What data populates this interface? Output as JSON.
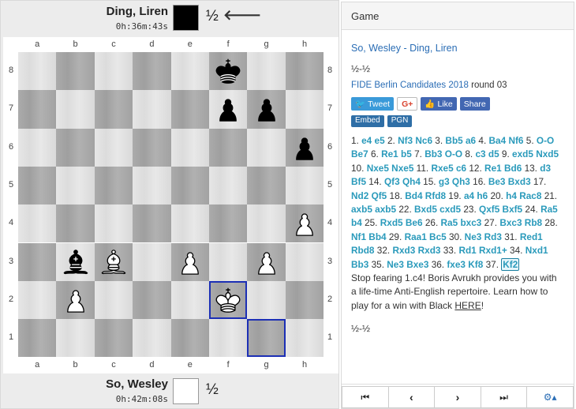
{
  "top_player": {
    "name": "Ding, Liren",
    "clock": "0h:36m:43s",
    "result": "½",
    "turn_arrow": "🡐"
  },
  "bottom_player": {
    "name": "So, Wesley",
    "clock": "0h:42m:08s",
    "result": "½"
  },
  "board": {
    "files": [
      "a",
      "b",
      "c",
      "d",
      "e",
      "f",
      "g",
      "h"
    ],
    "ranks": [
      "8",
      "7",
      "6",
      "5",
      "4",
      "3",
      "2",
      "1"
    ],
    "pieces": [
      {
        "square": "f8",
        "piece": "bk",
        "icon": "black-king-icon"
      },
      {
        "square": "f7",
        "piece": "bp",
        "icon": "black-pawn-icon"
      },
      {
        "square": "g7",
        "piece": "bp",
        "icon": "black-pawn-icon"
      },
      {
        "square": "h6",
        "piece": "bp",
        "icon": "black-pawn-icon"
      },
      {
        "square": "h4",
        "piece": "wp",
        "icon": "white-pawn-icon"
      },
      {
        "square": "b3",
        "piece": "bb",
        "icon": "black-bishop-icon"
      },
      {
        "square": "c3",
        "piece": "wb",
        "icon": "white-bishop-icon"
      },
      {
        "square": "e3",
        "piece": "wp",
        "icon": "white-pawn-icon"
      },
      {
        "square": "g3",
        "piece": "wp",
        "icon": "white-pawn-icon"
      },
      {
        "square": "b2",
        "piece": "wp",
        "icon": "white-pawn-icon"
      },
      {
        "square": "f2",
        "piece": "wk",
        "icon": "white-king-icon"
      }
    ],
    "highlights": [
      "f2",
      "g1"
    ],
    "highlight_color": "#1c2fb5"
  },
  "game": {
    "header": "Game",
    "white": "So, Wesley",
    "separator": " - ",
    "black": "Ding, Liren",
    "result": "½-½",
    "event": "FIDE Berlin Candidates 2018",
    "round": " round 03",
    "share": {
      "tweet": "Tweet",
      "gplus": "G+",
      "like": "Like",
      "share": "Share"
    },
    "embed": "Embed",
    "pgn": "PGN",
    "moves": [
      [
        "1.",
        "e4",
        "e5"
      ],
      [
        "2.",
        "Nf3",
        "Nc6"
      ],
      [
        "3.",
        "Bb5",
        "a6"
      ],
      [
        "4.",
        "Ba4",
        "Nf6"
      ],
      [
        "5.",
        "O-O",
        "Be7"
      ],
      [
        "6.",
        "Re1",
        "b5"
      ],
      [
        "7.",
        "Bb3",
        "O-O"
      ],
      [
        "8.",
        "c3",
        "d5"
      ],
      [
        "9.",
        "exd5",
        "Nxd5"
      ],
      [
        "10.",
        "Nxe5",
        "Nxe5"
      ],
      [
        "11.",
        "Rxe5",
        "c6"
      ],
      [
        "12.",
        "Re1",
        "Bd6"
      ],
      [
        "13.",
        "d3",
        "Bf5"
      ],
      [
        "14.",
        "Qf3",
        "Qh4"
      ],
      [
        "15.",
        "g3",
        "Qh3"
      ],
      [
        "16.",
        "Be3",
        "Bxd3"
      ],
      [
        "17.",
        "Nd2",
        "Qf5"
      ],
      [
        "18.",
        "Bd4",
        "Rfd8"
      ],
      [
        "19.",
        "a4",
        "h6"
      ],
      [
        "20.",
        "h4",
        "Rac8"
      ],
      [
        "21.",
        "axb5",
        "axb5"
      ],
      [
        "22.",
        "Bxd5",
        "cxd5"
      ],
      [
        "23.",
        "Qxf5",
        "Bxf5"
      ],
      [
        "24.",
        "Ra5",
        "b4"
      ],
      [
        "25.",
        "Rxd5",
        "Be6"
      ],
      [
        "26.",
        "Ra5",
        "bxc3"
      ],
      [
        "27.",
        "Bxc3",
        "Rb8"
      ],
      [
        "28.",
        "Nf1",
        "Bb4"
      ],
      [
        "29.",
        "Raa1",
        "Bc5"
      ],
      [
        "30.",
        "Ne3",
        "Rd3"
      ],
      [
        "31.",
        "Red1",
        "Rbd8"
      ],
      [
        "32.",
        "Rxd3",
        "Rxd3"
      ],
      [
        "33.",
        "Rd1",
        "Rxd1+"
      ],
      [
        "34.",
        "Nxd1",
        "Bb3"
      ],
      [
        "35.",
        "Ne3",
        "Bxe3"
      ],
      [
        "36.",
        "fxe3",
        "Kf8"
      ],
      [
        "37.",
        "Kf2",
        ""
      ]
    ],
    "promo_text": "Stop fearing 1.c4! Boris Avrukh provides you with a life-time Anti-English repertoire. Learn how to play for a win with Black ",
    "promo_link": "HERE",
    "promo_end": "!",
    "result_bottom": "½-½",
    "nav": [
      "first-icon",
      "prev-icon",
      "next-icon",
      "last-icon",
      "gear-icon"
    ]
  }
}
